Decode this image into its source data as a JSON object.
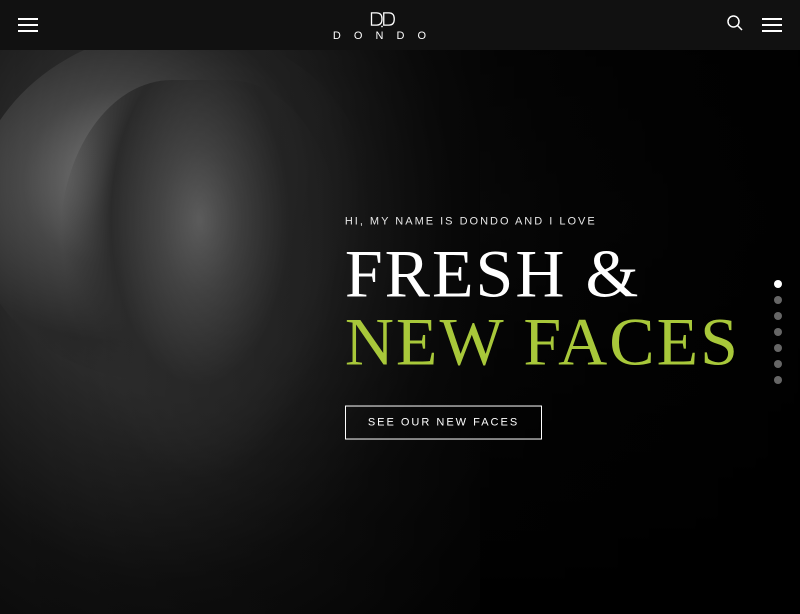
{
  "nav": {
    "logo_text": "D O N D O",
    "hamburger_left_label": "Menu Left",
    "hamburger_right_label": "Menu Right",
    "search_label": "Search"
  },
  "hero": {
    "subtitle": "HI, MY NAME IS DONDO AND I LOVE",
    "title_line1": "FRESH &",
    "title_line2": "NEW FACES",
    "cta_label": "SEE OUR NEW FACES",
    "dots": [
      {
        "active": true
      },
      {
        "active": false
      },
      {
        "active": false
      },
      {
        "active": false
      },
      {
        "active": false
      },
      {
        "active": false
      },
      {
        "active": false
      }
    ]
  },
  "colors": {
    "accent": "#a8c83a",
    "nav_bg": "#111111",
    "hero_text": "#ffffff"
  }
}
